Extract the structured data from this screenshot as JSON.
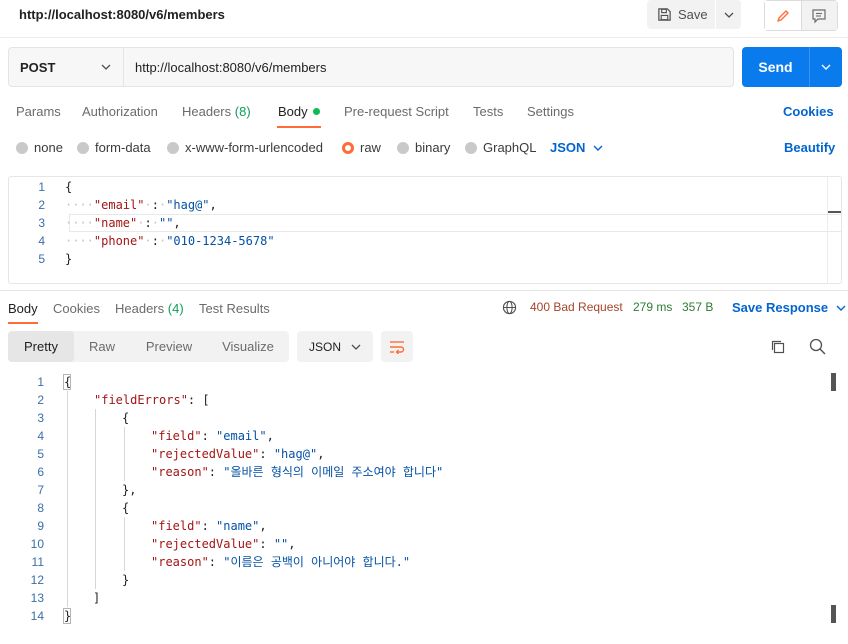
{
  "header": {
    "request_title": "http://localhost:8080/v6/members",
    "save_label": "Save"
  },
  "url_bar": {
    "method": "POST",
    "url": "http://localhost:8080/v6/members",
    "send_label": "Send"
  },
  "request_tabs": {
    "params": "Params",
    "authorization": "Authorization",
    "headers": "Headers",
    "headers_count": "(8)",
    "body": "Body",
    "prerequest": "Pre-request Script",
    "tests": "Tests",
    "settings": "Settings",
    "cookies": "Cookies"
  },
  "body_types": {
    "none": "none",
    "form_data": "form-data",
    "urlencoded": "x-www-form-urlencoded",
    "raw": "raw",
    "binary": "binary",
    "graphql": "GraphQL",
    "selected": "raw",
    "language": "JSON",
    "beautify": "Beautify"
  },
  "request_body": {
    "line_numbers": [
      "1",
      "2",
      "3",
      "4",
      "5"
    ],
    "open": "{",
    "close": "}",
    "lines": [
      {
        "key": "\"email\"",
        "value": "\"hag@\"",
        "trail": ","
      },
      {
        "key": "\"name\"",
        "value": "\"\"",
        "trail": ","
      },
      {
        "key": "\"phone\"",
        "value": "\"010-1234-5678\"",
        "trail": ""
      }
    ]
  },
  "response_tabs": {
    "body": "Body",
    "cookies": "Cookies",
    "headers": "Headers",
    "headers_count": "(4)",
    "test_results": "Test Results",
    "status": "400 Bad Request",
    "time": "279 ms",
    "size": "357 B",
    "save_response": "Save Response"
  },
  "response_view": {
    "pretty": "Pretty",
    "raw": "Raw",
    "preview": "Preview",
    "visualize": "Visualize",
    "format": "JSON"
  },
  "response_body": {
    "line_numbers": [
      "1",
      "2",
      "3",
      "4",
      "5",
      "6",
      "7",
      "8",
      "9",
      "10",
      "11",
      "12",
      "13",
      "14"
    ],
    "l1": "{",
    "l2_key": "\"fieldErrors\"",
    "l2_rest": ": [",
    "l3": "{",
    "l4_key": "\"field\"",
    "l4_val": "\"email\"",
    "l5_key": "\"rejectedValue\"",
    "l5_val": "\"hag@\"",
    "l6_key": "\"reason\"",
    "l6_val": "\"올바른 형식의 이메일 주소여야 합니다\"",
    "l7": "},",
    "l8": "{",
    "l9_key": "\"field\"",
    "l9_val": "\"name\"",
    "l10_key": "\"rejectedValue\"",
    "l10_val": "\"\"",
    "l11_key": "\"reason\"",
    "l11_val": "\"이름은 공백이 아니어야 합니다.\"",
    "l12": "}",
    "l13": "]",
    "l14": "}"
  },
  "colors": {
    "accent": "#ff6c37",
    "primary": "#097bed",
    "link": "#0265d2",
    "key": "#a31515",
    "string": "#0451a5"
  }
}
